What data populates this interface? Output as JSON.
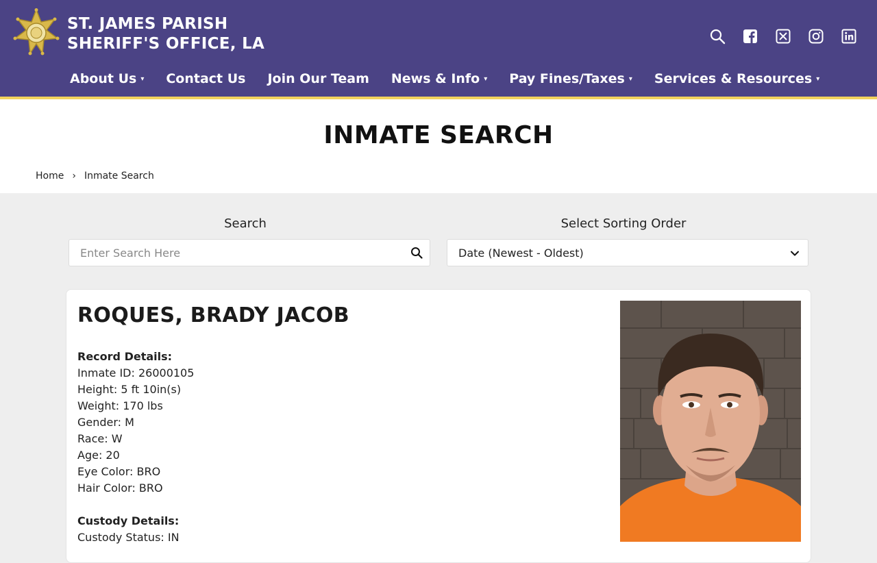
{
  "header": {
    "title_line1": "ST. JAMES PARISH",
    "title_line2": "SHERIFF'S OFFICE, LA",
    "colors": {
      "primary": "#4b4385",
      "accent": "#f2d35c"
    },
    "social_icons": [
      "search-icon",
      "facebook-icon",
      "x-icon",
      "instagram-icon",
      "linkedin-icon"
    ]
  },
  "nav": {
    "items": [
      {
        "label": "About Us",
        "dropdown": true
      },
      {
        "label": "Contact Us",
        "dropdown": false
      },
      {
        "label": "Join Our Team",
        "dropdown": false
      },
      {
        "label": "News & Info",
        "dropdown": true
      },
      {
        "label": "Pay Fines/Taxes",
        "dropdown": true
      },
      {
        "label": "Services & Resources",
        "dropdown": true
      }
    ],
    "caret": "▾"
  },
  "page": {
    "title": "INMATE SEARCH",
    "breadcrumb": {
      "home": "Home",
      "separator": "›",
      "current": "Inmate Search"
    }
  },
  "search": {
    "label": "Search",
    "placeholder": "Enter Search Here",
    "value": ""
  },
  "sort": {
    "label": "Select Sorting Order",
    "selected": "Date (Newest - Oldest)"
  },
  "inmate": {
    "name": "ROQUES, BRADY JACOB",
    "record_heading": "Record Details:",
    "record": [
      "Inmate ID: 26000105",
      "Height: 5 ft 10in(s)",
      "Weight: 170 lbs",
      "Gender: M",
      "Race: W",
      "Age: 20",
      "Eye Color: BRO",
      "Hair Color: BRO"
    ],
    "custody_heading": "Custody Details:",
    "custody": [
      "Custody Status: IN"
    ]
  }
}
